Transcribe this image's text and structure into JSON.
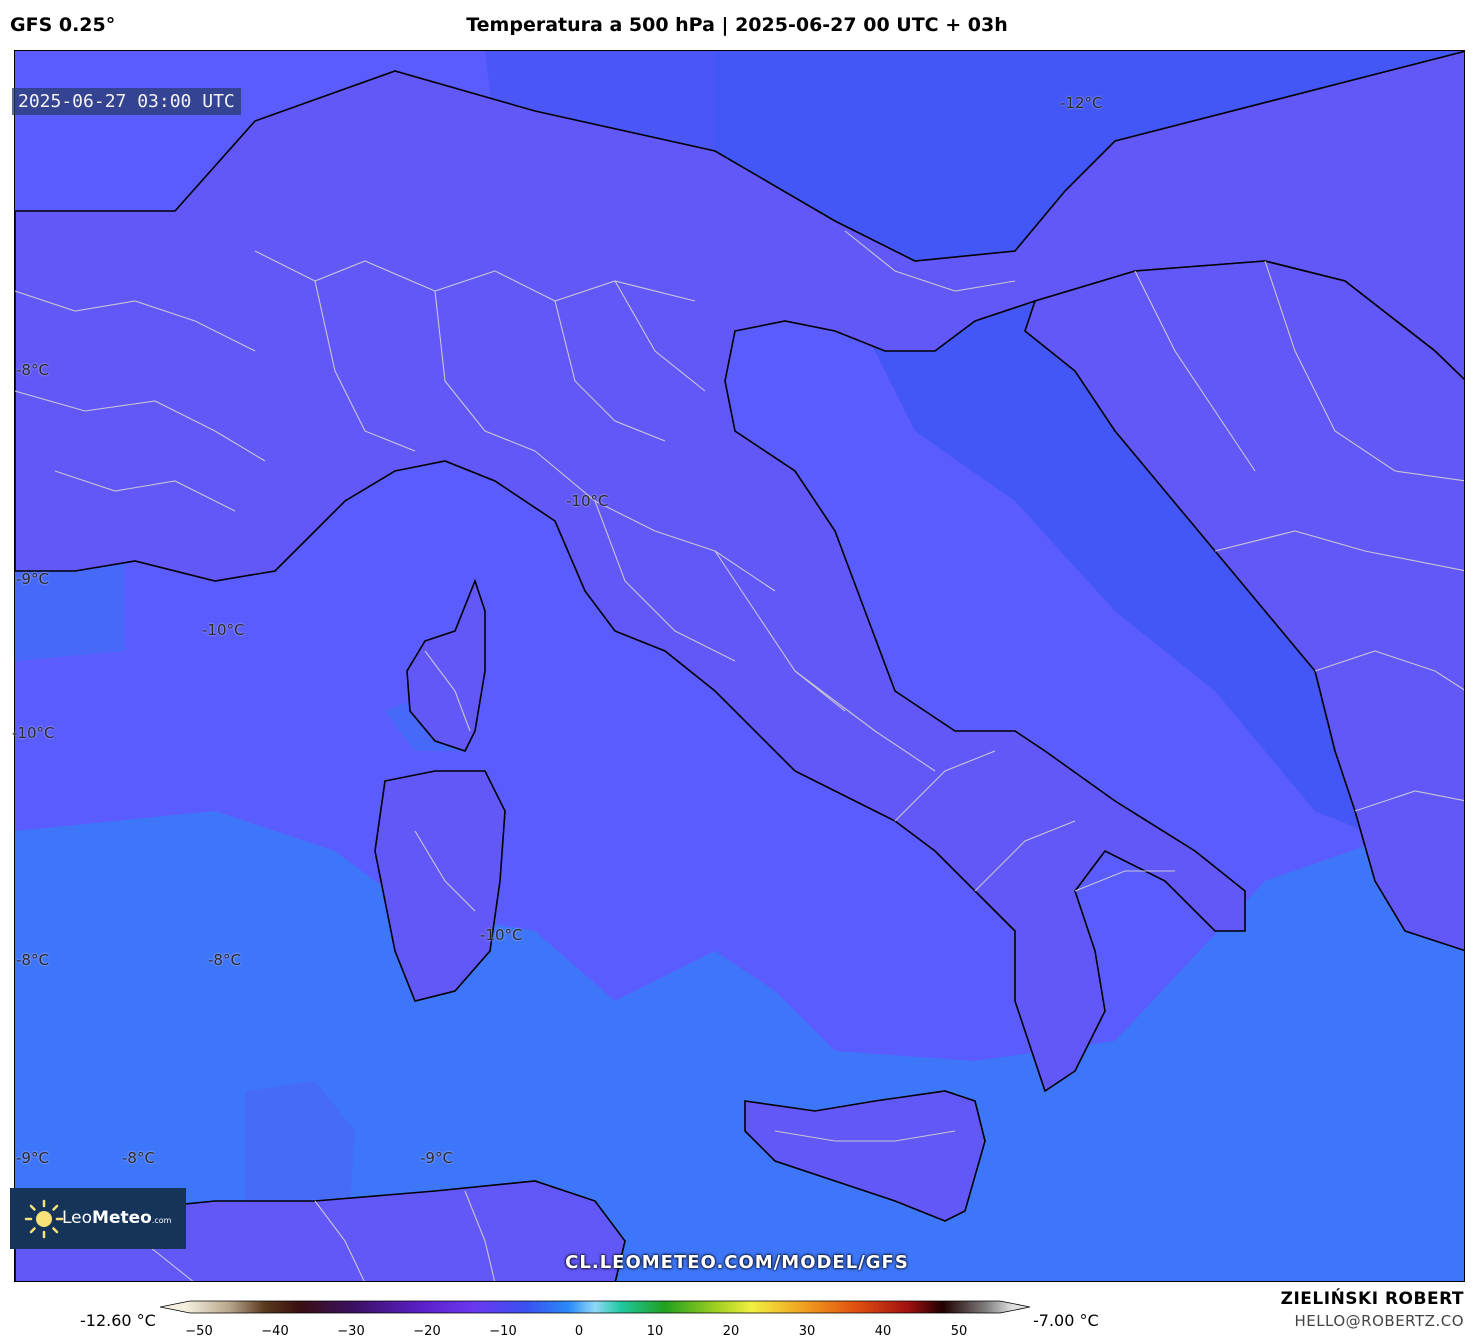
{
  "header": {
    "model": "GFS 0.25°",
    "title": "Temperatura a 500 hPa | 2025-06-27 00 UTC + 03h"
  },
  "map": {
    "valid_time": "2025-06-27 03:00 UTC",
    "isotherm_labels": [
      "-12°C",
      "-8°C",
      "-10°C",
      "-9°C",
      "-10°C",
      "-10°C",
      "-8°C",
      "-10°C",
      "-8°C",
      "-9°C",
      "-8°C",
      "-9°C"
    ],
    "colors": {
      "sea_fill": "#5a5cfd",
      "cold_fill": "#3f56f5",
      "warm_fill": "#3a7af8",
      "land_fill": "#6258f8",
      "coastline": "#000000",
      "borders": "#d2d2d2"
    },
    "logo": {
      "brand_light": "Leo",
      "brand_bold": "Meteo",
      "suffix": ".com"
    },
    "url": "CL.LEOMETEO.COM/MODEL/GFS"
  },
  "colorbar": {
    "min_label": "-12.60 °C",
    "max_label": "-7.00 °C",
    "ticks": [
      "−50",
      "−40",
      "−30",
      "−20",
      "−10",
      "0",
      "10",
      "20",
      "30",
      "40",
      "50"
    ]
  },
  "credits": {
    "author": "ZIELIŃSKI ROBERT",
    "email": "HELLO@ROBERTZ.CO"
  }
}
